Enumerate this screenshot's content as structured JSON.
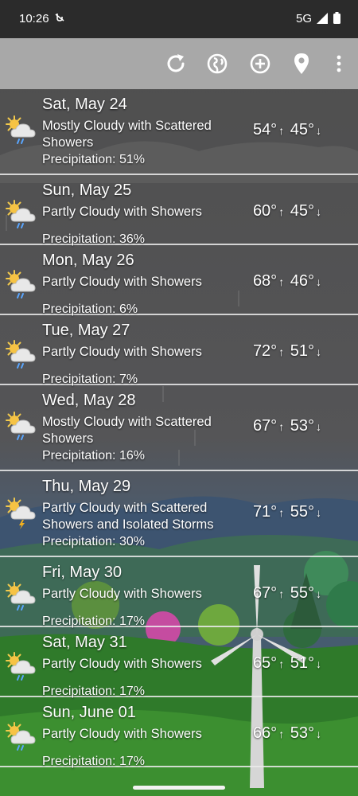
{
  "status": {
    "time": "10:26",
    "network": "5G"
  },
  "toolbar": {
    "icons": [
      "refresh-icon",
      "globe-icon",
      "add-location-icon",
      "location-pin-icon",
      "overflow-menu-icon"
    ]
  },
  "forecast": [
    {
      "date": "Sat, May 24",
      "desc": "Mostly Cloudy with Scattered Showers",
      "precip": "Precipitation:  51%",
      "high": "54°",
      "low": "45°",
      "icon": "cloud-sun-rain-icon"
    },
    {
      "date": "Sun, May 25",
      "desc": "Partly Cloudy with Showers",
      "precip": "Precipitation:  36%",
      "high": "60°",
      "low": "45°",
      "icon": "cloud-sun-rain-icon"
    },
    {
      "date": "Mon, May 26",
      "desc": "Partly Cloudy with Showers",
      "precip": "Precipitation:  6%",
      "high": "68°",
      "low": "46°",
      "icon": "cloud-sun-rain-icon"
    },
    {
      "date": "Tue, May 27",
      "desc": "Partly Cloudy with Showers",
      "precip": "Precipitation:  7%",
      "high": "72°",
      "low": "51°",
      "icon": "cloud-sun-rain-icon"
    },
    {
      "date": "Wed, May 28",
      "desc": "Mostly Cloudy with Scattered Showers",
      "precip": "Precipitation:  16%",
      "high": "67°",
      "low": "53°",
      "icon": "cloud-sun-rain-icon"
    },
    {
      "date": "Thu, May 29",
      "desc": "Partly Cloudy with Scattered Showers and Isolated Storms",
      "precip": "Precipitation:  30%",
      "high": "71°",
      "low": "55°",
      "icon": "cloud-sun-storm-icon"
    },
    {
      "date": "Fri, May 30",
      "desc": "Partly Cloudy with Showers",
      "precip": "Precipitation:  17%",
      "high": "67°",
      "low": "55°",
      "icon": "cloud-sun-rain-icon"
    },
    {
      "date": "Sat, May 31",
      "desc": "Partly Cloudy with Showers",
      "precip": "Precipitation:  17%",
      "high": "65°",
      "low": "51°",
      "icon": "cloud-sun-rain-icon"
    },
    {
      "date": "Sun, June 01",
      "desc": "Partly Cloudy with Showers",
      "precip": "Precipitation:  17%",
      "high": "66°",
      "low": "53°",
      "icon": "cloud-sun-rain-icon"
    }
  ],
  "arrows": {
    "up": "↑",
    "down": "↓"
  }
}
